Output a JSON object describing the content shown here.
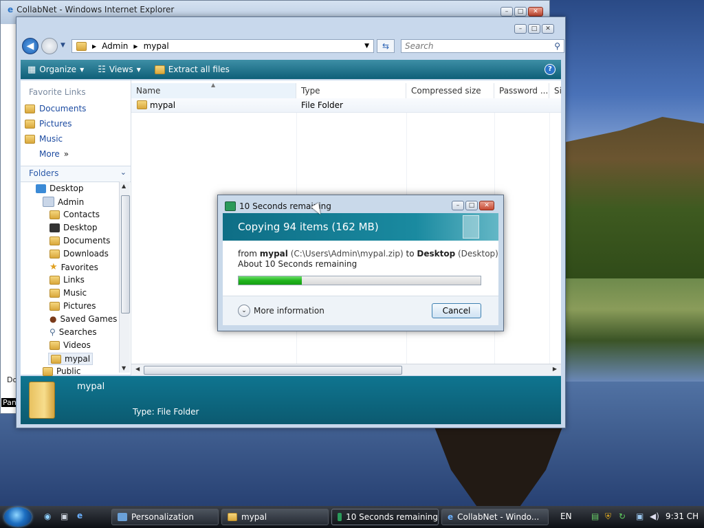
{
  "ie_window": {
    "title": "CollabNet - Windows Internet Explorer"
  },
  "explorer": {
    "breadcrumb": [
      "Admin",
      "mypal"
    ],
    "search_placeholder": "Search",
    "toolbar": {
      "organize": "Organize",
      "views": "Views",
      "extract": "Extract all files"
    },
    "favorite_links_header": "Favorite Links",
    "favorite_links": [
      "Documents",
      "Pictures",
      "Music",
      "More"
    ],
    "folders_header": "Folders",
    "tree": [
      "Desktop",
      "Admin",
      "Contacts",
      "Desktop",
      "Documents",
      "Downloads",
      "Favorites",
      "Links",
      "Music",
      "Pictures",
      "Saved Games",
      "Searches",
      "Videos",
      "mypal",
      "Public"
    ],
    "columns": [
      "Name",
      "Type",
      "Compressed size",
      "Password ...",
      "Si"
    ],
    "rows": [
      {
        "name": "mypal",
        "type": "File Folder"
      }
    ],
    "details": {
      "name": "mypal",
      "type_label": "Type:",
      "type_value": "File Folder"
    }
  },
  "dialog": {
    "title": "10 Seconds remaining",
    "banner": "Copying 94 items (162 MB)",
    "from_label": "from",
    "source_name": "mypal",
    "source_path": "(C:\\Users\\Admin\\mypal.zip)",
    "to_label": "to",
    "dest_name": "Desktop",
    "dest_path": "(Desktop)",
    "remaining": "About 10 Seconds remaining",
    "progress_fraction": 0.26,
    "more_info": "More information",
    "cancel": "Cancel"
  },
  "taskbar": {
    "tasks": [
      "Personalization",
      "mypal",
      "10 Seconds remaining",
      "CollabNet - Windo..."
    ],
    "language": "EN",
    "clock": "9:31 CH"
  },
  "desktop_fragments": {
    "left_a": "Do",
    "left_b": "Pan"
  },
  "colors": {
    "accent_teal": "#0e6e86",
    "progress_green": "#22b41e",
    "link_blue": "#1b4aa0"
  }
}
